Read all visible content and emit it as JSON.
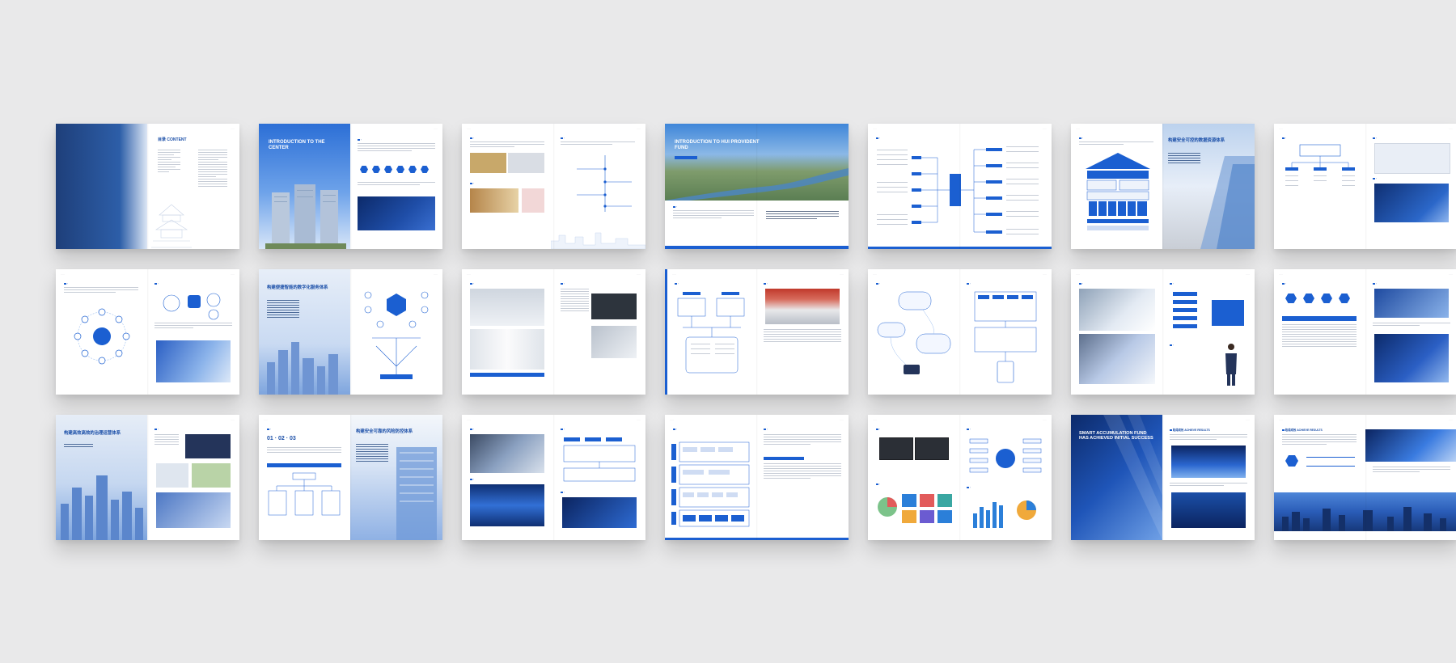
{
  "brochure": {
    "accent": "#1b5fd1",
    "dark_accent": "#1e3f7a",
    "background": "#e9e9ea"
  },
  "spreads": {
    "contents": {
      "title_cn": "目录",
      "title_en": "CONTENT"
    },
    "intro_center": {
      "title": "INTRODUCTION TO THE CENTER"
    },
    "intro_fund": {
      "title": "INTRODUCTION TO HUI PROVIDENT FUND"
    },
    "security_system": {
      "title_cn": "构建安全可控的数据资源体系"
    },
    "digital_service": {
      "title_cn": "构建便捷智能的数字化服务体系"
    },
    "efficient_ops": {
      "title_cn": "构建高效高效的治理运营体系"
    },
    "risk_control": {
      "title_cn": "构建安全可靠的风险防控体系"
    },
    "results": {
      "title": "SMART ACCUMULATION FUND HAS ACHIEVED INITIAL SUCCESS",
      "section_cn": "取得成效",
      "section_en": "ACHIEVE RESULTS"
    }
  }
}
